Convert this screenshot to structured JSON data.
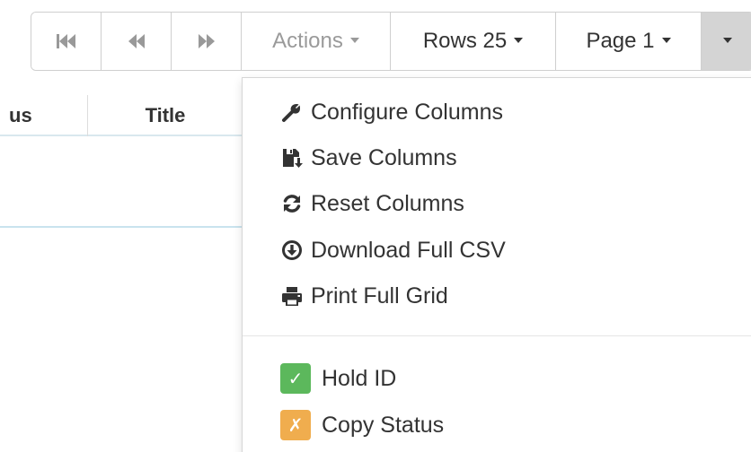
{
  "toolbar": {
    "first_icon": "first-page-icon",
    "prev_icon": "previous-page-icon",
    "next_icon": "next-page-icon",
    "actions_label": "Actions",
    "rows_label": "Rows 25",
    "page_label": "Page 1",
    "more_icon": "caret-down-icon"
  },
  "grid": {
    "columns": [
      "us",
      "Title"
    ]
  },
  "menu": {
    "items": [
      {
        "label": "Configure Columns",
        "icon": "wrench-icon"
      },
      {
        "label": "Save Columns",
        "icon": "save-icon"
      },
      {
        "label": "Reset Columns",
        "icon": "refresh-icon"
      },
      {
        "label": "Download Full CSV",
        "icon": "download-icon"
      },
      {
        "label": "Print Full Grid",
        "icon": "print-icon"
      }
    ],
    "checks": [
      {
        "label": "Hold ID",
        "mark": "✓",
        "color": "#5cb85c",
        "checked": true
      },
      {
        "label": "Copy Status",
        "mark": "✗",
        "color": "#f0ad4e",
        "checked": false
      }
    ]
  }
}
